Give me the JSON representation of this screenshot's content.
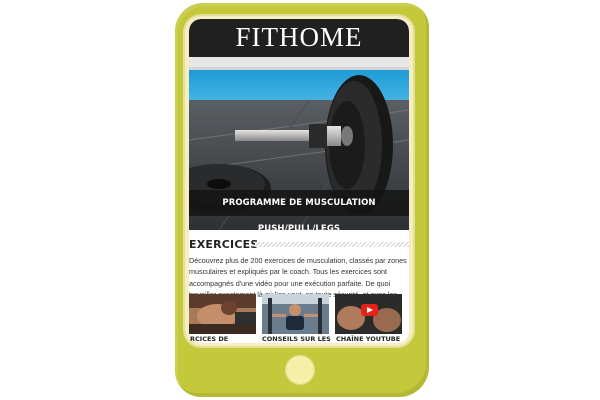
{
  "app": {
    "title": "FITHOME"
  },
  "hero": {
    "caption": "PROGRAMME DE MUSCULATION PUSH/PULL/LEGS"
  },
  "exercises": {
    "heading": "EXERCICES",
    "description": "Découvrez plus de 200 exercices de musculation, classés par zones musculaires et expliqués par le coach. Tous les exercices sont accompagnés d'une vidéo pour une exécution parfaite. De quoi travailler exactement là où l'on veut, en toute sécurité, et avec les meilleurs conseils !"
  },
  "thumbnails": [
    {
      "label": "RCICES DE",
      "icon": "abs-workout-photo"
    },
    {
      "label": "CONSEILS SUR LES",
      "icon": "gym-machine-photo"
    },
    {
      "label": "CHAÎNE YOUTUBE",
      "icon": "youtube-play-icon"
    }
  ],
  "colors": {
    "device": "#c3c93a",
    "header": "#202020",
    "home_button": "#f6efa7",
    "youtube": "#e62117"
  }
}
